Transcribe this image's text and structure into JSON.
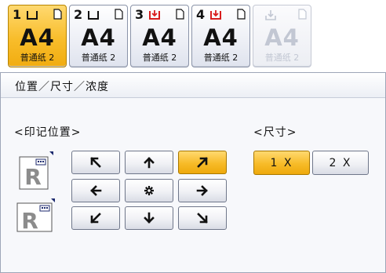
{
  "trays": [
    {
      "number": "1",
      "size": "A4",
      "paper_type": "普通纸 2",
      "icon": "paper-tray-icon",
      "state": "selected"
    },
    {
      "number": "2",
      "size": "A4",
      "paper_type": "普通纸 2",
      "icon": "paper-tray-icon",
      "state": "normal"
    },
    {
      "number": "3",
      "size": "A4",
      "paper_type": "普通纸 2",
      "icon": "paper-tray-down-arrow-icon",
      "state": "normal"
    },
    {
      "number": "4",
      "size": "A4",
      "paper_type": "普通纸 2",
      "icon": "paper-tray-down-arrow-icon",
      "state": "normal"
    },
    {
      "number": "",
      "size": "A4",
      "paper_type": "普通纸 2",
      "icon": "bypass-tray-icon",
      "state": "disabled"
    }
  ],
  "panel": {
    "title": "位置／尺寸／浓度",
    "position_label": "<印记位置>",
    "size_label": "<尺寸>"
  },
  "orientation_icons": [
    "portrait-r-icon",
    "landscape-r-icon"
  ],
  "position_buttons": [
    {
      "icon": "arrow-up-left-icon",
      "selected": false
    },
    {
      "icon": "arrow-up-icon",
      "selected": false
    },
    {
      "icon": "arrow-up-right-icon",
      "selected": true
    },
    {
      "icon": "arrow-left-icon",
      "selected": false
    },
    {
      "icon": "center-asterisk-icon",
      "selected": false
    },
    {
      "icon": "arrow-right-icon",
      "selected": false
    },
    {
      "icon": "arrow-down-left-icon",
      "selected": false
    },
    {
      "icon": "arrow-down-icon",
      "selected": false
    },
    {
      "icon": "arrow-down-right-icon",
      "selected": false
    }
  ],
  "size_buttons": [
    {
      "label": "1 X",
      "selected": true
    },
    {
      "label": "2 X",
      "selected": false
    }
  ],
  "colors": {
    "accent": "#f7bb28",
    "tray_down_arrow": "#d81e1e"
  }
}
